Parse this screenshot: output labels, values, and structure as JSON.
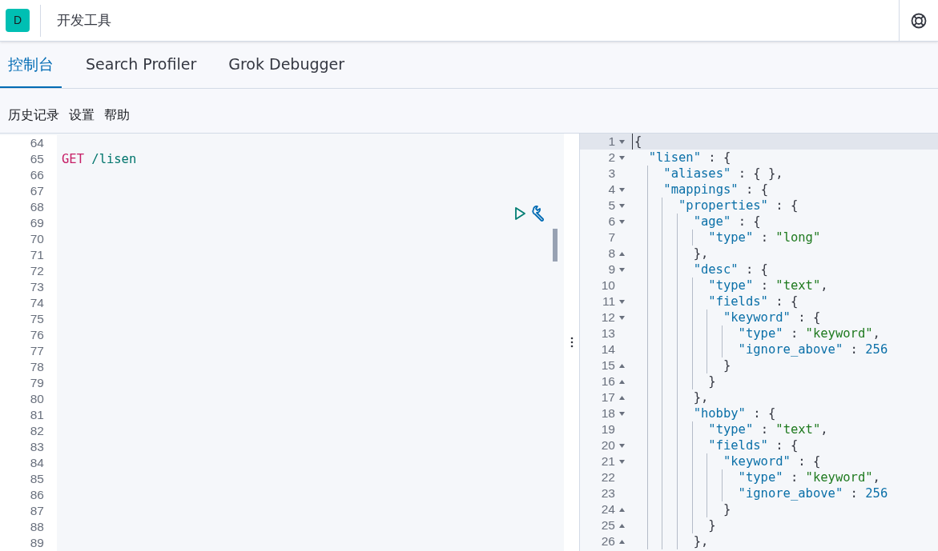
{
  "header": {
    "logo_letter": "D",
    "title": "开发工具"
  },
  "tabs": [
    {
      "label": "控制台",
      "selected": true
    },
    {
      "label": "Search Profiler",
      "selected": false
    },
    {
      "label": "Grok Debugger",
      "selected": false
    }
  ],
  "menu": [
    "历史记录",
    "设置",
    "帮助"
  ],
  "request_editor": {
    "lines": [
      {
        "number": "64"
      },
      {
        "number": "65",
        "tokens": [
          {
            "kind": "method",
            "text": "GET"
          },
          {
            "kind": "url",
            "text": "/lisen"
          }
        ]
      },
      {
        "number": "66"
      },
      {
        "number": "67"
      },
      {
        "number": "68"
      },
      {
        "number": "69"
      },
      {
        "number": "70"
      },
      {
        "number": "71"
      },
      {
        "number": "72"
      },
      {
        "number": "73"
      },
      {
        "number": "74"
      },
      {
        "number": "75"
      },
      {
        "number": "76"
      },
      {
        "number": "77"
      },
      {
        "number": "78"
      },
      {
        "number": "79"
      },
      {
        "number": "80"
      },
      {
        "number": "81"
      },
      {
        "number": "82"
      },
      {
        "number": "83"
      },
      {
        "number": "84"
      },
      {
        "number": "85"
      },
      {
        "number": "86"
      },
      {
        "number": "87"
      },
      {
        "number": "88"
      },
      {
        "number": "89"
      }
    ]
  },
  "response_editor": {
    "lines": [
      {
        "number": "1",
        "kind": "opener",
        "selected": true,
        "tokens": [
          {
            "kind": "punct",
            "text": "{"
          }
        ],
        "children": [
          {
            "number": "2",
            "kind": "opener",
            "selected": false,
            "tokens": [
              {
                "kind": "key",
                "text": "\"lisen\""
              },
              {
                "kind": "punct",
                "text": " : {"
              }
            ],
            "children": [
              {
                "number": "3",
                "kind": "line",
                "selected": false,
                "tokens": [
                  {
                    "kind": "key",
                    "text": "\"aliases\""
                  },
                  {
                    "kind": "punct",
                    "text": " : { },"
                  }
                ]
              },
              {
                "number": "4",
                "kind": "opener",
                "selected": false,
                "tokens": [
                  {
                    "kind": "key",
                    "text": "\"mappings\""
                  },
                  {
                    "kind": "punct",
                    "text": " : {"
                  }
                ],
                "children": [
                  {
                    "number": "5",
                    "kind": "opener",
                    "selected": false,
                    "tokens": [
                      {
                        "kind": "key",
                        "text": "\"properties\""
                      },
                      {
                        "kind": "punct",
                        "text": " : {"
                      }
                    ],
                    "children": [
                      {
                        "number": "6",
                        "kind": "opener",
                        "selected": false,
                        "tokens": [
                          {
                            "kind": "key",
                            "text": "\"age\""
                          },
                          {
                            "kind": "punct",
                            "text": " : {"
                          }
                        ],
                        "children": [
                          {
                            "number": "7",
                            "kind": "line",
                            "selected": false,
                            "tokens": [
                              {
                                "kind": "key",
                                "text": "\"type\""
                              },
                              {
                                "kind": "punct",
                                "text": " : "
                              },
                              {
                                "kind": "string",
                                "text": "\"long\""
                              }
                            ]
                          }
                        ]
                      },
                      {
                        "number": "8",
                        "kind": "closer",
                        "selected": false,
                        "tokens": [
                          {
                            "kind": "punct",
                            "text": "},"
                          }
                        ]
                      },
                      {
                        "number": "9",
                        "kind": "opener",
                        "selected": false,
                        "tokens": [
                          {
                            "kind": "key",
                            "text": "\"desc\""
                          },
                          {
                            "kind": "punct",
                            "text": " : {"
                          }
                        ],
                        "children": [
                          {
                            "number": "10",
                            "kind": "line",
                            "selected": false,
                            "tokens": [
                              {
                                "kind": "key",
                                "text": "\"type\""
                              },
                              {
                                "kind": "punct",
                                "text": " : "
                              },
                              {
                                "kind": "string",
                                "text": "\"text\""
                              },
                              {
                                "kind": "punct",
                                "text": ","
                              }
                            ]
                          },
                          {
                            "number": "11",
                            "kind": "opener",
                            "selected": false,
                            "tokens": [
                              {
                                "kind": "key",
                                "text": "\"fields\""
                              },
                              {
                                "kind": "punct",
                                "text": " : {"
                              }
                            ],
                            "children": [
                              {
                                "number": "12",
                                "kind": "opener",
                                "selected": false,
                                "tokens": [
                                  {
                                    "kind": "key",
                                    "text": "\"keyword\""
                                  },
                                  {
                                    "kind": "punct",
                                    "text": " : {"
                                  }
                                ],
                                "children": [
                                  {
                                    "number": "13",
                                    "kind": "line",
                                    "selected": false,
                                    "tokens": [
                                      {
                                        "kind": "key",
                                        "text": "\"type\""
                                      },
                                      {
                                        "kind": "punct",
                                        "text": " : "
                                      },
                                      {
                                        "kind": "string",
                                        "text": "\"keyword\""
                                      },
                                      {
                                        "kind": "punct",
                                        "text": ","
                                      }
                                    ]
                                  },
                                  {
                                    "number": "14",
                                    "kind": "line",
                                    "selected": false,
                                    "tokens": [
                                      {
                                        "kind": "key",
                                        "text": "\"ignore_above\""
                                      },
                                      {
                                        "kind": "punct",
                                        "text": " : "
                                      },
                                      {
                                        "kind": "number",
                                        "text": "256"
                                      }
                                    ]
                                  }
                                ]
                              },
                              {
                                "number": "15",
                                "kind": "closer",
                                "selected": false,
                                "tokens": [
                                  {
                                    "kind": "punct",
                                    "text": "}"
                                  }
                                ]
                              }
                            ]
                          },
                          {
                            "number": "16",
                            "kind": "closer",
                            "selected": false,
                            "tokens": [
                              {
                                "kind": "punct",
                                "text": "}"
                              }
                            ]
                          }
                        ]
                      },
                      {
                        "number": "17",
                        "kind": "closer",
                        "selected": false,
                        "tokens": [
                          {
                            "kind": "punct",
                            "text": "},"
                          }
                        ]
                      },
                      {
                        "number": "18",
                        "kind": "opener",
                        "selected": false,
                        "tokens": [
                          {
                            "kind": "key",
                            "text": "\"hobby\""
                          },
                          {
                            "kind": "punct",
                            "text": " : {"
                          }
                        ],
                        "children": [
                          {
                            "number": "19",
                            "kind": "line",
                            "selected": false,
                            "tokens": [
                              {
                                "kind": "key",
                                "text": "\"type\""
                              },
                              {
                                "kind": "punct",
                                "text": " : "
                              },
                              {
                                "kind": "string",
                                "text": "\"text\""
                              },
                              {
                                "kind": "punct",
                                "text": ","
                              }
                            ]
                          },
                          {
                            "number": "20",
                            "kind": "opener",
                            "selected": false,
                            "tokens": [
                              {
                                "kind": "key",
                                "text": "\"fields\""
                              },
                              {
                                "kind": "punct",
                                "text": " : {"
                              }
                            ],
                            "children": [
                              {
                                "number": "21",
                                "kind": "opener",
                                "selected": false,
                                "tokens": [
                                  {
                                    "kind": "key",
                                    "text": "\"keyword\""
                                  },
                                  {
                                    "kind": "punct",
                                    "text": " : {"
                                  }
                                ],
                                "children": [
                                  {
                                    "number": "22",
                                    "kind": "line",
                                    "selected": false,
                                    "tokens": [
                                      {
                                        "kind": "key",
                                        "text": "\"type\""
                                      },
                                      {
                                        "kind": "punct",
                                        "text": " : "
                                      },
                                      {
                                        "kind": "string",
                                        "text": "\"keyword\""
                                      },
                                      {
                                        "kind": "punct",
                                        "text": ","
                                      }
                                    ]
                                  },
                                  {
                                    "number": "23",
                                    "kind": "line",
                                    "selected": false,
                                    "tokens": [
                                      {
                                        "kind": "key",
                                        "text": "\"ignore_above\""
                                      },
                                      {
                                        "kind": "punct",
                                        "text": " : "
                                      },
                                      {
                                        "kind": "number",
                                        "text": "256"
                                      }
                                    ]
                                  }
                                ]
                              },
                              {
                                "number": "24",
                                "kind": "closer",
                                "selected": false,
                                "tokens": [
                                  {
                                    "kind": "punct",
                                    "text": "}"
                                  }
                                ]
                              }
                            ]
                          },
                          {
                            "number": "25",
                            "kind": "closer",
                            "selected": false,
                            "tokens": [
                              {
                                "kind": "punct",
                                "text": "}"
                              }
                            ]
                          }
                        ]
                      },
                      {
                        "number": "26",
                        "kind": "closer",
                        "selected": false,
                        "tokens": [
                          {
                            "kind": "punct",
                            "text": "},"
                          }
                        ]
                      }
                    ]
                  }
                ]
              }
            ]
          }
        ]
      }
    ]
  }
}
